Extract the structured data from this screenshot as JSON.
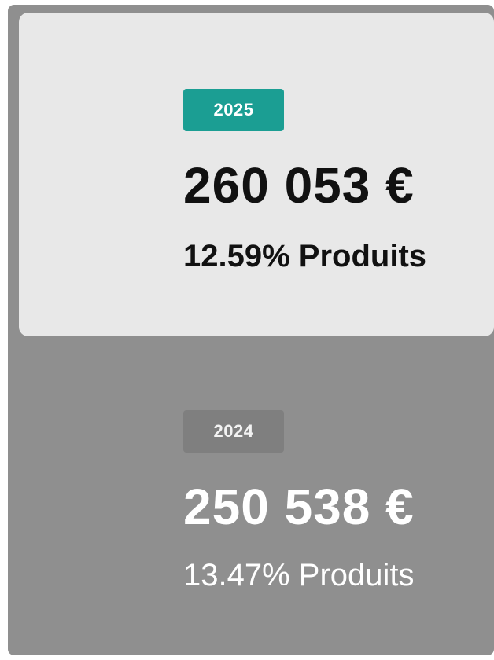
{
  "current_year": {
    "year": "2025",
    "amount": "260 053 €",
    "share": "12.59% Produits",
    "badge_color": "#1b9e93",
    "card_color": "#e8e8e8"
  },
  "previous_year": {
    "year": "2024",
    "amount": "250 538 €",
    "share": "13.47% Produits",
    "badge_color": "#7f7f7f",
    "card_color": "#8f8f8f"
  }
}
